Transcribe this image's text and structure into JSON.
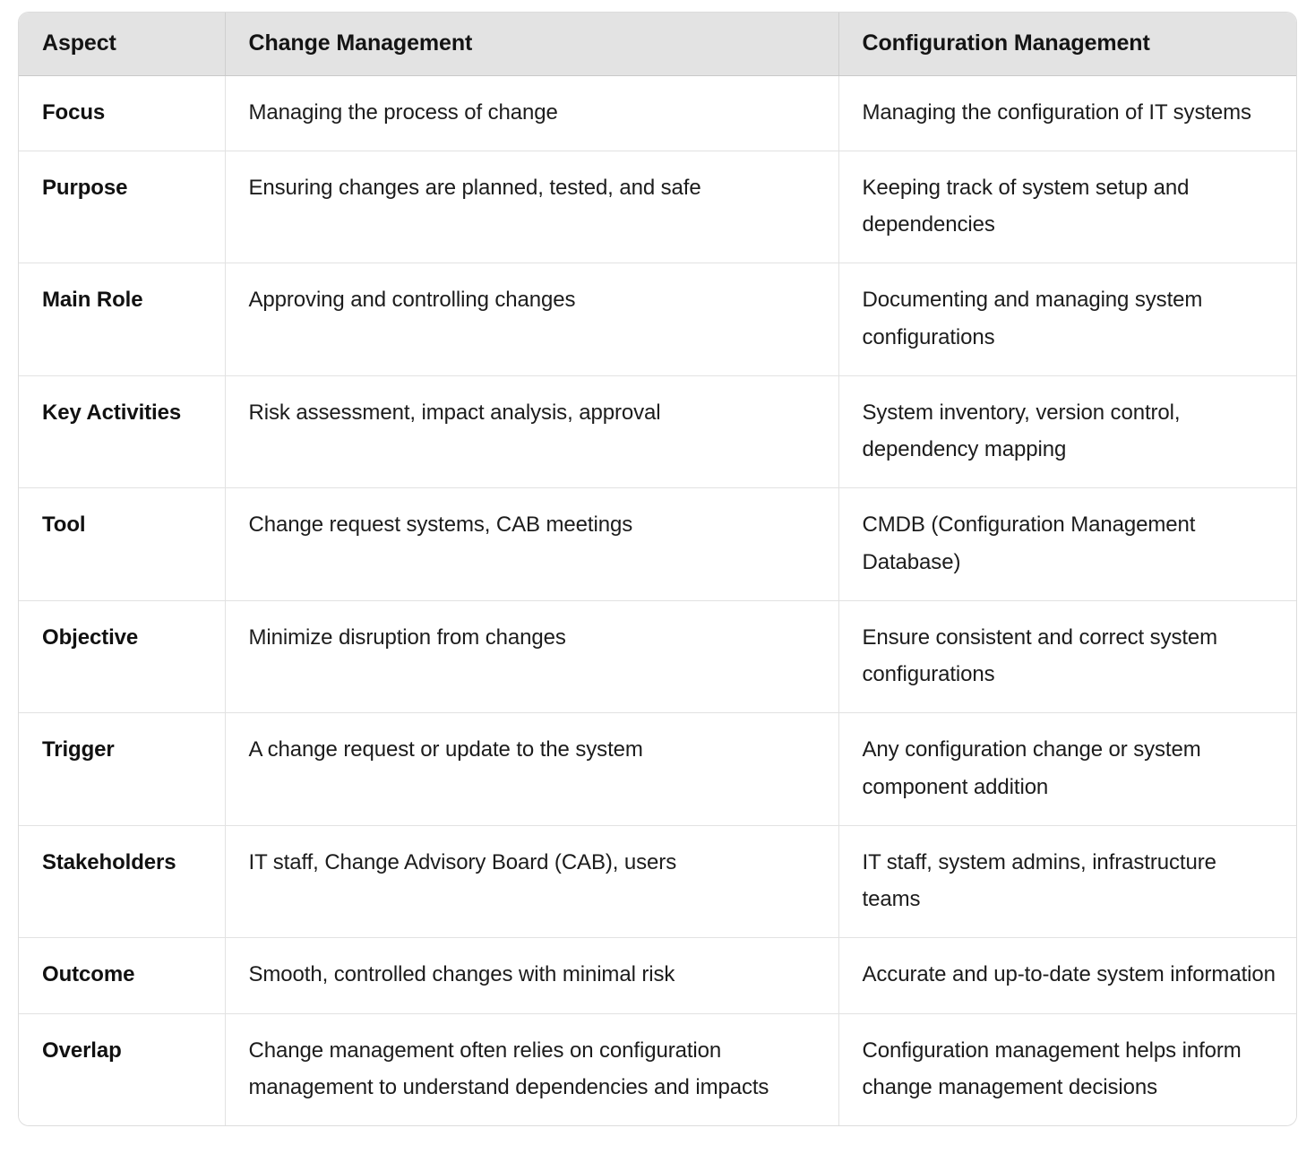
{
  "table": {
    "columns": [
      {
        "key": "aspect",
        "label": "Aspect"
      },
      {
        "key": "change_management",
        "label": "Change Management"
      },
      {
        "key": "configuration_management",
        "label": "Configuration Management"
      }
    ],
    "rows": [
      {
        "aspect": "Focus",
        "change_management": "Managing the process of change",
        "configuration_management": "Managing the configuration of IT systems"
      },
      {
        "aspect": "Purpose",
        "change_management": "Ensuring changes are planned, tested, and safe",
        "configuration_management": "Keeping track of system setup and dependencies"
      },
      {
        "aspect": "Main Role",
        "change_management": "Approving and controlling changes",
        "configuration_management": "Documenting and managing system configurations"
      },
      {
        "aspect": "Key Activities",
        "change_management": "Risk assessment, impact analysis, approval",
        "configuration_management": "System inventory, version control, dependency mapping"
      },
      {
        "aspect": "Tool",
        "change_management": "Change request systems, CAB meetings",
        "configuration_management": "CMDB (Configuration Management Database)"
      },
      {
        "aspect": "Objective",
        "change_management": "Minimize disruption from changes",
        "configuration_management": "Ensure consistent and correct system configurations"
      },
      {
        "aspect": "Trigger",
        "change_management": "A change request or update to the system",
        "configuration_management": "Any configuration change or system component addition"
      },
      {
        "aspect": "Stakeholders",
        "change_management": "IT staff, Change Advisory Board (CAB), users",
        "configuration_management": "IT staff, system admins, infrastructure teams"
      },
      {
        "aspect": "Outcome",
        "change_management": "Smooth, controlled changes with minimal risk",
        "configuration_management": "Accurate and up-to-date system information"
      },
      {
        "aspect": "Overlap",
        "change_management": "Change management often relies on configuration management to understand dependencies and impacts",
        "configuration_management": "Configuration management helps inform change management decisions"
      }
    ]
  },
  "colors": {
    "header_background": "#e3e3e3",
    "outer_border": "#dcdcdc",
    "cell_border": "#e2e2e2",
    "text": "#1c1c1c",
    "heading_text": "#141414",
    "page_background": "#ffffff"
  }
}
